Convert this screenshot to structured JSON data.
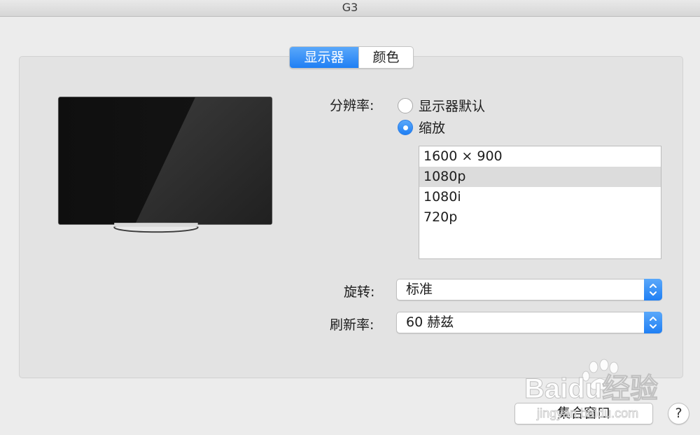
{
  "window": {
    "title": "G3"
  },
  "tabs": [
    {
      "label": "显示器",
      "active": true
    },
    {
      "label": "颜色",
      "active": false
    }
  ],
  "resolution": {
    "label": "分辨率:",
    "options": [
      {
        "label": "显示器默认",
        "selected": false
      },
      {
        "label": "缩放",
        "selected": true
      }
    ],
    "list": [
      "1600 × 900",
      "1080p",
      "1080i",
      "720p"
    ],
    "selected_index": 1
  },
  "rotation": {
    "label": "旋转:",
    "value": "标准"
  },
  "refresh": {
    "label": "刷新率:",
    "value": "60 赫兹"
  },
  "footer": {
    "gather_label": "集合窗口",
    "help_label": "?"
  },
  "watermark": {
    "text": "Baidu经验",
    "url": "jingyan.baidu.com"
  },
  "colors": {
    "accent": "#1f7ff4",
    "background": "#ececec",
    "panel": "#e3e3e3"
  }
}
